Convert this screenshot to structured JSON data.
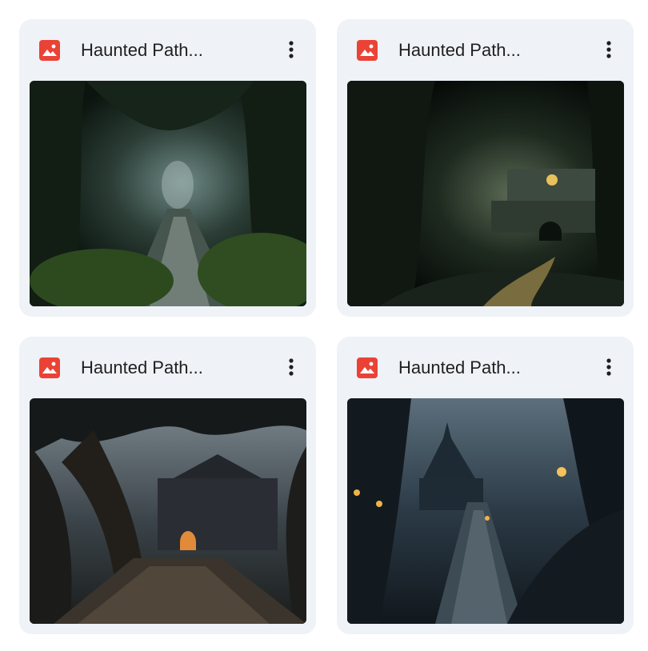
{
  "files": [
    {
      "title": "Haunted Path...",
      "icon": "image-file-icon",
      "menu_icon": "more-vert-icon",
      "accent": "#ea4335"
    },
    {
      "title": "Haunted Path...",
      "icon": "image-file-icon",
      "menu_icon": "more-vert-icon",
      "accent": "#ea4335"
    },
    {
      "title": "Haunted Path...",
      "icon": "image-file-icon",
      "menu_icon": "more-vert-icon",
      "accent": "#ea4335"
    },
    {
      "title": "Haunted Path...",
      "icon": "image-file-icon",
      "menu_icon": "more-vert-icon",
      "accent": "#ea4335"
    }
  ]
}
